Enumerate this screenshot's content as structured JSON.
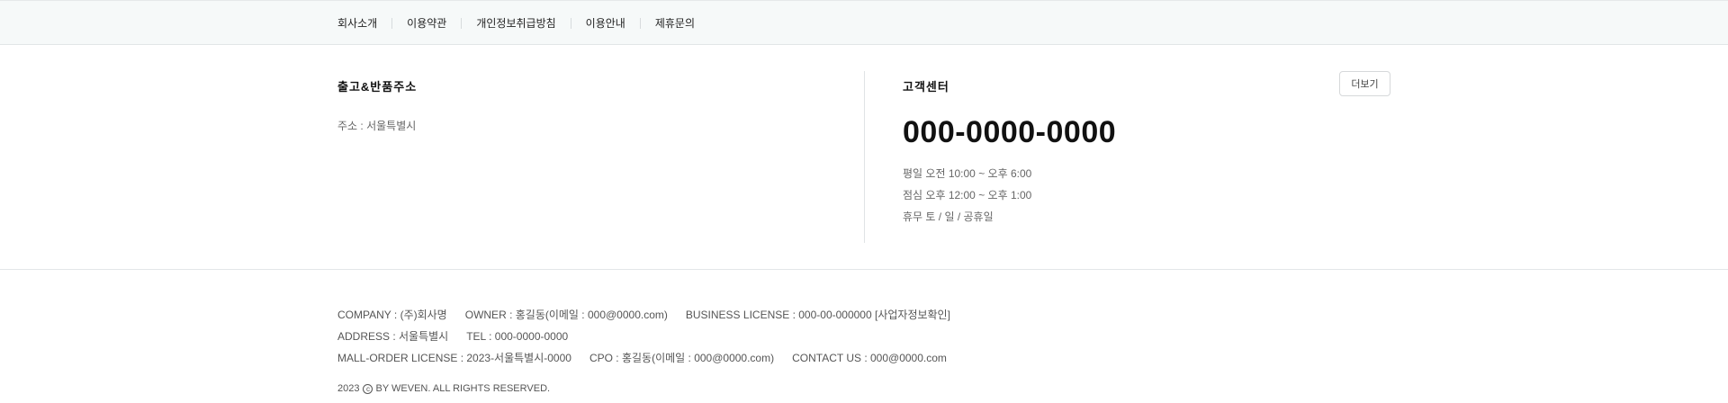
{
  "nav": {
    "items": [
      "회사소개",
      "이용약관",
      "개인정보취급방침",
      "이용안내",
      "제휴문의"
    ]
  },
  "shipping": {
    "title": "출고&반품주소",
    "address": "주소 : 서울특별시"
  },
  "support": {
    "title": "고객센터",
    "more_button": "더보기",
    "phone": "000-0000-0000",
    "hours": [
      "평일 오전 10:00 ~ 오후 6:00",
      "점심 오후 12:00 ~ 오후 1:00",
      "휴무 토 / 일 / 공휴일"
    ]
  },
  "company_info": {
    "lines": [
      [
        "COMPANY : (주)회사명",
        "OWNER : 홍길동(이메일 : 000@0000.com)",
        "BUSINESS LICENSE : 000-00-000000 [사업자정보확인]"
      ],
      [
        "ADDRESS : 서울특별시",
        "TEL : 000-0000-0000"
      ],
      [
        "MALL-ORDER LICENSE : 2023-서울특별시-0000",
        "CPO : 홍길동(이메일 : 000@0000.com)",
        "CONTACT US : 000@0000.com"
      ]
    ],
    "copyright_year": "2023",
    "copyright_text": "BY WEVEN. ALL RIGHTS RESERVED."
  }
}
